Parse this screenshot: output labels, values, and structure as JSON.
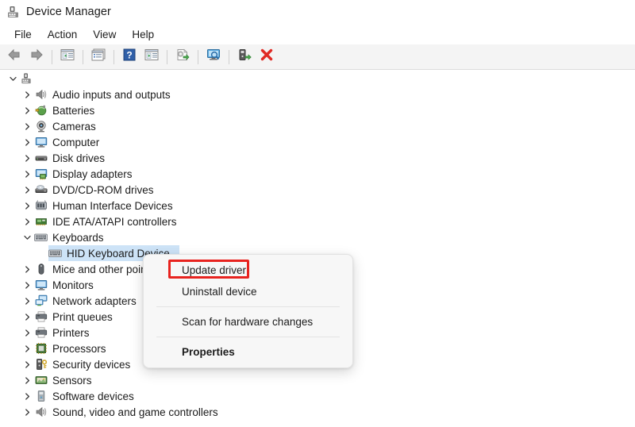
{
  "window": {
    "title": "Device Manager",
    "icon": "device-manager-icon"
  },
  "menubar": {
    "items": [
      {
        "label": "File"
      },
      {
        "label": "Action"
      },
      {
        "label": "View"
      },
      {
        "label": "Help"
      }
    ]
  },
  "toolbar": {
    "buttons": [
      {
        "name": "back-button",
        "icon": "arrow-left-icon"
      },
      {
        "name": "forward-button",
        "icon": "arrow-right-icon"
      },
      {
        "name": "show-hide-console-tree-button",
        "icon": "console-tree-icon"
      },
      {
        "name": "properties-button",
        "icon": "properties-window-icon"
      },
      {
        "name": "help-button",
        "icon": "question-mark-icon"
      },
      {
        "name": "show-hide-action-pane-button",
        "icon": "action-pane-icon"
      },
      {
        "name": "update-driver-button",
        "icon": "update-driver-icon"
      },
      {
        "name": "scan-for-hardware-changes-button",
        "icon": "scan-monitor-icon"
      },
      {
        "name": "enable-device-button",
        "icon": "enable-device-icon"
      },
      {
        "name": "uninstall-device-button",
        "icon": "red-x-icon"
      }
    ]
  },
  "tree": {
    "root": {
      "label": "",
      "icon": "computer-root-icon",
      "expanded": true
    },
    "items": [
      {
        "label": "Audio inputs and outputs",
        "icon": "speaker-icon",
        "expanded": false,
        "depth": 1
      },
      {
        "label": "Batteries",
        "icon": "battery-icon",
        "expanded": false,
        "depth": 1
      },
      {
        "label": "Cameras",
        "icon": "camera-icon",
        "expanded": false,
        "depth": 1
      },
      {
        "label": "Computer",
        "icon": "monitor-icon",
        "expanded": false,
        "depth": 1
      },
      {
        "label": "Disk drives",
        "icon": "disk-drive-icon",
        "expanded": false,
        "depth": 1
      },
      {
        "label": "Display adapters",
        "icon": "display-adapter-icon",
        "expanded": false,
        "depth": 1
      },
      {
        "label": "DVD/CD-ROM drives",
        "icon": "optical-drive-icon",
        "expanded": false,
        "depth": 1
      },
      {
        "label": "Human Interface Devices",
        "icon": "hid-icon",
        "expanded": false,
        "depth": 1
      },
      {
        "label": "IDE ATA/ATAPI controllers",
        "icon": "ide-controller-icon",
        "expanded": false,
        "depth": 1
      },
      {
        "label": "Keyboards",
        "icon": "keyboard-icon",
        "expanded": true,
        "depth": 1
      },
      {
        "label": "HID Keyboard Device",
        "icon": "keyboard-icon",
        "expanded": null,
        "depth": 2,
        "selected": true
      },
      {
        "label": "Mice and other pointing devices",
        "icon": "mouse-icon",
        "expanded": false,
        "depth": 1
      },
      {
        "label": "Monitors",
        "icon": "monitor-icon",
        "expanded": false,
        "depth": 1
      },
      {
        "label": "Network adapters",
        "icon": "network-adapter-icon",
        "expanded": false,
        "depth": 1
      },
      {
        "label": "Print queues",
        "icon": "printer-icon",
        "expanded": false,
        "depth": 1
      },
      {
        "label": "Printers",
        "icon": "printer-icon",
        "expanded": false,
        "depth": 1
      },
      {
        "label": "Processors",
        "icon": "processor-icon",
        "expanded": false,
        "depth": 1
      },
      {
        "label": "Security devices",
        "icon": "security-device-icon",
        "expanded": false,
        "depth": 1
      },
      {
        "label": "Sensors",
        "icon": "sensor-icon",
        "expanded": false,
        "depth": 1
      },
      {
        "label": "Software devices",
        "icon": "software-device-icon",
        "expanded": false,
        "depth": 1
      },
      {
        "label": "Sound, video and game controllers",
        "icon": "speaker-icon",
        "expanded": false,
        "depth": 1
      }
    ]
  },
  "context_menu": {
    "items": [
      {
        "label": "Update driver",
        "bold": false,
        "highlighted": true
      },
      {
        "label": "Uninstall device",
        "bold": false,
        "highlighted": false
      },
      {
        "label": "Scan for hardware changes",
        "bold": false,
        "highlighted": false
      },
      {
        "label": "Properties",
        "bold": true,
        "highlighted": false
      }
    ]
  },
  "colors": {
    "selection": "#cde3f7",
    "annotation": "#e8231f",
    "toolbar_bg": "#f4f4f4",
    "menu_bg": "#f7f7f7"
  }
}
